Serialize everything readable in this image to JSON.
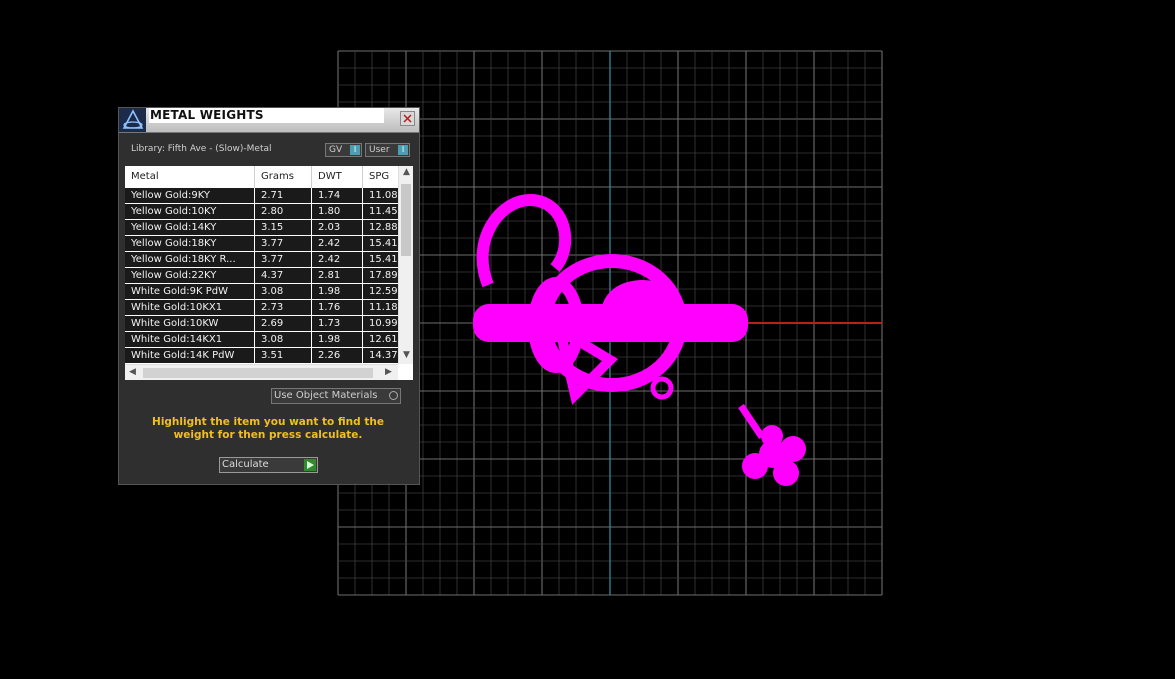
{
  "panel": {
    "title": "METAL WEIGHTS",
    "library_label": "Library: Fifth Ave - (Slow)-Metal",
    "toggles": [
      {
        "label": "GV",
        "knob": "I"
      },
      {
        "label": "User",
        "knob": "I"
      }
    ],
    "table": {
      "columns": [
        "Metal",
        "Grams",
        "DWT",
        "SPG"
      ],
      "rows": [
        [
          "Yellow Gold:9KY",
          "2.71",
          "1.74",
          "11.08"
        ],
        [
          "Yellow Gold:10KY",
          "2.80",
          "1.80",
          "11.45"
        ],
        [
          "Yellow Gold:14KY",
          "3.15",
          "2.03",
          "12.88"
        ],
        [
          "Yellow Gold:18KY",
          "3.77",
          "2.42",
          "15.41"
        ],
        [
          "Yellow Gold:18KY R...",
          "3.77",
          "2.42",
          "15.41"
        ],
        [
          "Yellow Gold:22KY",
          "4.37",
          "2.81",
          "17.89"
        ],
        [
          "White Gold:9K PdW",
          "3.08",
          "1.98",
          "12.59"
        ],
        [
          "White Gold:10KX1",
          "2.73",
          "1.76",
          "11.18"
        ],
        [
          "White Gold:10KW",
          "2.69",
          "1.73",
          "10.99"
        ],
        [
          "White Gold:14KX1",
          "3.08",
          "1.98",
          "12.61"
        ],
        [
          "White Gold:14K PdW",
          "3.51",
          "2.26",
          "14.37"
        ]
      ]
    },
    "use_object_materials": "Use Object Materials",
    "instructions": "Highlight the item you want to find the weight for then press calculate.",
    "calculate_label": "Calculate"
  },
  "colors": {
    "viewport_bg": "#000000",
    "grid": "#5a5a5a",
    "axis_y": "#2c8fa3",
    "axis_x": "#b3241b",
    "model": "#ff00ff",
    "instructions": "#f0c020"
  },
  "icons": [
    "app-logo-icon",
    "close-icon",
    "chevron-up-icon",
    "chevron-down-icon",
    "chevron-left-icon",
    "chevron-right-icon",
    "play-icon"
  ]
}
